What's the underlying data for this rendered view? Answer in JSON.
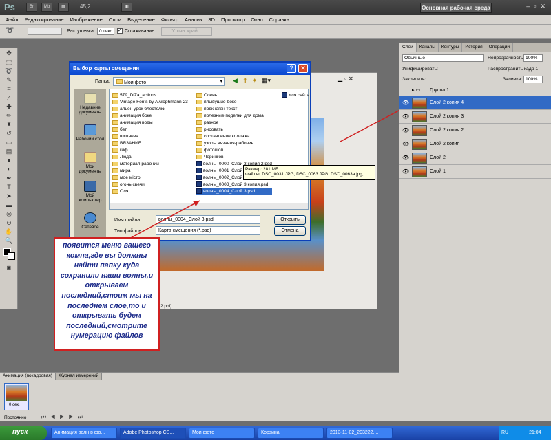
{
  "app": {
    "logo": "Ps",
    "zoom": "45,2",
    "workspace": "Основная рабочая среда"
  },
  "menu": [
    "Файл",
    "Редактирование",
    "Изображение",
    "Слои",
    "Выделение",
    "Фильтр",
    "Анализ",
    "3D",
    "Просмотр",
    "Окно",
    "Справка"
  ],
  "options": {
    "feather_label": "Растушевка:",
    "feather_value": "0 пикс",
    "antialias_label": "Сглаживание",
    "refine_label": "Уточн. край..."
  },
  "dialog": {
    "title": "Выбор карты смещения",
    "look_in_label": "Папка:",
    "look_in_value": "Мои фото",
    "places": [
      {
        "label": "Недавние документы",
        "icon": "recent-documents-icon"
      },
      {
        "label": "Рабочий стол",
        "icon": "desktop-icon"
      },
      {
        "label": "Мои документы",
        "icon": "my-documents-icon"
      },
      {
        "label": "Мой компьютер",
        "icon": "my-computer-icon"
      },
      {
        "label": "Сетевое",
        "icon": "network-icon"
      }
    ],
    "files_col1": [
      "579_DiZa_actions",
      "Vintage Fonts by A.Gophmann 23",
      "альен урок блестелки",
      "анимация боке",
      "анимация воды",
      "бет",
      "вишнева",
      "ВЯЗАНИЕ",
      "гиф",
      "Люда",
      "материал рабочий",
      "мира",
      "мое місто",
      "огонь свечи",
      "Оля"
    ],
    "files_col2": [
      "Осень",
      "плывущие боке",
      "подкнаген текст",
      "полезные поделки для дома",
      "разное",
      "рисовать",
      "составление коллажа",
      "узоры вязания-рабочие",
      "фотошоп",
      "Черингов"
    ],
    "files_col2_psd": [
      "волны_0000_Слой 3 копия 2.psd",
      "волны_0001_Слой 3...",
      "волны_0002_Слой 3...",
      "волны_0003_Слой 3 копия.psd",
      "волны_0004_Слой 3.psd"
    ],
    "files_col3": [
      "для сайта"
    ],
    "filename_label": "Имя файла:",
    "filename_value": "волны_0004_Слой 3.psd",
    "filetype_label": "Тип файлов:",
    "filetype_value": "Карта смещения (*.psd)",
    "open_label": "Открыть",
    "cancel_label": "Отмена",
    "tooltip_size": "Размер: 281 МБ",
    "tooltip_files": "Файлы: DSC_0031.JPG, DSC_0063.JPG, DSC_0063a.jpg, ..."
  },
  "doc": {
    "info": "2 ppi)"
  },
  "note": "появится меню вашего компа,где вы должны найти папку куда сохранили наши волны,и открываем последний,стоим мы на последнем слое,то и открывать будем последний,смотрите нумерацию файлов",
  "panel": {
    "tabs": [
      "Слои",
      "Каналы",
      "Контуры",
      "История",
      "Операции"
    ],
    "blend_mode": "Обычные",
    "opacity_label": "Непрозрачность:",
    "opacity_value": "100%",
    "unify_label": "Унифицировать:",
    "propagate_label": "Распространить кадр 1",
    "lock_label": "Закрепить:",
    "fill_label": "Заливка:",
    "fill_value": "100%",
    "group_name": "Группа 1",
    "layers": [
      "Слой 2 копия 4",
      "Слой 2 копия 3",
      "Слой 2 копия 2",
      "Слой 2 копия",
      "Слой 2",
      "Слой 1"
    ]
  },
  "anim": {
    "tabs": [
      "Анимация (покадровая)",
      "Журнал измерений"
    ],
    "frame_time": "0 сек.",
    "loop": "Постоянно"
  },
  "taskbar": {
    "start": "пуск",
    "tasks": [
      "Анимация волн в фо...",
      "Adobe Photoshop CS...",
      "Мои фото",
      "Корзина",
      "2013-11-02_203222...."
    ],
    "lang": "RU",
    "time": "21:04"
  }
}
